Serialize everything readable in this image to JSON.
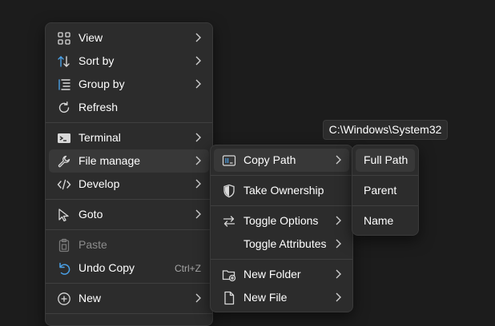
{
  "main_menu": {
    "items": [
      {
        "label": "View",
        "icon": "grid-icon"
      },
      {
        "label": "Sort by",
        "icon": "sort-icon"
      },
      {
        "label": "Group by",
        "icon": "group-list-icon"
      },
      {
        "label": "Refresh",
        "icon": "refresh-icon"
      },
      {
        "label": "Terminal",
        "icon": "terminal-icon"
      },
      {
        "label": "File manage",
        "icon": "wrench-icon"
      },
      {
        "label": "Develop",
        "icon": "code-icon"
      },
      {
        "label": "Goto",
        "icon": "cursor-icon"
      },
      {
        "label": "Paste",
        "icon": "clipboard-icon"
      },
      {
        "label": "Undo Copy",
        "icon": "undo-icon",
        "shortcut": "Ctrl+Z"
      },
      {
        "label": "New",
        "icon": "add-circle-icon"
      }
    ]
  },
  "file_menu": {
    "items": [
      {
        "label": "Copy Path",
        "icon": "copy-path-icon"
      },
      {
        "label": "Take Ownership",
        "icon": "shield-icon"
      },
      {
        "label": "Toggle Options",
        "icon": "toggle-arrows-icon"
      },
      {
        "label": "Toggle Attributes"
      },
      {
        "label": "New Folder",
        "icon": "new-folder-icon"
      },
      {
        "label": "New File",
        "icon": "new-file-icon"
      }
    ]
  },
  "copy_menu": {
    "items": [
      {
        "label": "Full Path"
      },
      {
        "label": "Parent"
      },
      {
        "label": "Name"
      }
    ]
  },
  "tooltip": {
    "text": "C:\\Windows\\System32"
  },
  "colors": {
    "accent": "#4aa0e6",
    "background": "#1c1c1c",
    "menu": "#2c2c2c",
    "highlight": "#383838"
  }
}
